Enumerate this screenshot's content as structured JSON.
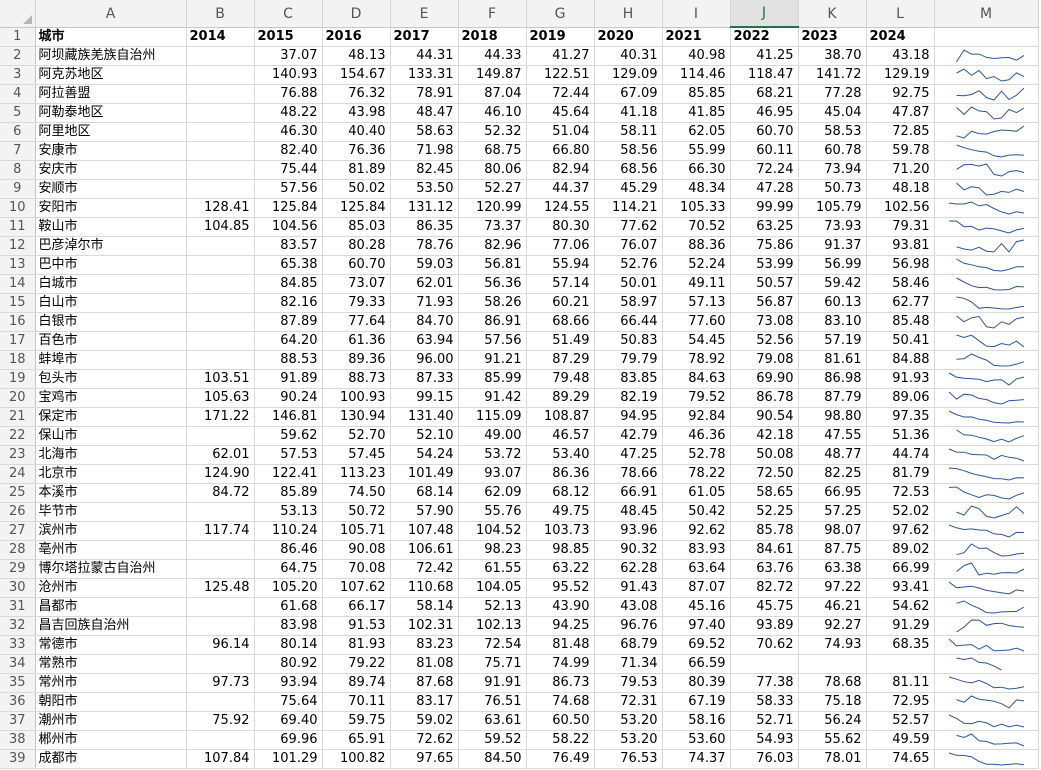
{
  "columns": [
    "A",
    "B",
    "C",
    "D",
    "E",
    "F",
    "G",
    "H",
    "I",
    "J",
    "K",
    "L",
    "M"
  ],
  "selected_column": "J",
  "header_row": [
    "城市",
    "2014",
    "2015",
    "2016",
    "2017",
    "2018",
    "2019",
    "2020",
    "2021",
    "2022",
    "2023",
    "2024"
  ],
  "rows": [
    [
      "阿坝藏族羌族自治州",
      "",
      "37.07",
      "48.13",
      "44.31",
      "44.33",
      "41.27",
      "40.31",
      "40.98",
      "41.25",
      "38.70",
      "43.18"
    ],
    [
      "阿克苏地区",
      "",
      "140.93",
      "154.67",
      "133.31",
      "149.87",
      "122.51",
      "129.09",
      "114.46",
      "118.47",
      "141.72",
      "129.19"
    ],
    [
      "阿拉善盟",
      "",
      "76.88",
      "76.32",
      "78.91",
      "87.04",
      "72.44",
      "67.09",
      "85.85",
      "68.21",
      "77.28",
      "92.75"
    ],
    [
      "阿勒泰地区",
      "",
      "48.22",
      "43.98",
      "48.47",
      "46.10",
      "45.64",
      "41.18",
      "41.85",
      "46.95",
      "45.04",
      "47.87"
    ],
    [
      "阿里地区",
      "",
      "46.30",
      "40.40",
      "58.63",
      "52.32",
      "51.04",
      "58.11",
      "62.05",
      "60.70",
      "58.53",
      "72.85"
    ],
    [
      "安康市",
      "",
      "82.40",
      "76.36",
      "71.98",
      "68.75",
      "66.80",
      "58.56",
      "55.99",
      "60.11",
      "60.78",
      "59.78"
    ],
    [
      "安庆市",
      "",
      "75.44",
      "81.89",
      "82.45",
      "80.06",
      "82.94",
      "68.56",
      "66.30",
      "72.24",
      "73.94",
      "71.20"
    ],
    [
      "安顺市",
      "",
      "57.56",
      "50.02",
      "53.50",
      "52.27",
      "44.37",
      "45.29",
      "48.34",
      "47.28",
      "50.73",
      "48.18"
    ],
    [
      "安阳市",
      "128.41",
      "125.84",
      "125.84",
      "131.12",
      "120.99",
      "124.55",
      "114.21",
      "105.33",
      "99.99",
      "105.79",
      "102.56"
    ],
    [
      "鞍山市",
      "104.85",
      "104.56",
      "85.03",
      "86.35",
      "73.37",
      "80.30",
      "77.62",
      "70.52",
      "63.25",
      "73.93",
      "79.31"
    ],
    [
      "巴彦淖尔市",
      "",
      "83.57",
      "80.28",
      "78.76",
      "82.96",
      "77.06",
      "76.07",
      "88.36",
      "75.86",
      "91.37",
      "93.81"
    ],
    [
      "巴中市",
      "",
      "65.38",
      "60.70",
      "59.03",
      "56.81",
      "55.94",
      "52.76",
      "52.24",
      "53.99",
      "56.99",
      "56.98"
    ],
    [
      "白城市",
      "",
      "84.85",
      "73.07",
      "62.01",
      "56.36",
      "57.14",
      "50.01",
      "49.11",
      "50.57",
      "59.42",
      "58.46"
    ],
    [
      "白山市",
      "",
      "82.16",
      "79.33",
      "71.93",
      "58.26",
      "60.21",
      "58.97",
      "57.13",
      "56.87",
      "60.13",
      "62.77"
    ],
    [
      "白银市",
      "",
      "87.89",
      "77.64",
      "84.70",
      "86.91",
      "68.66",
      "66.44",
      "77.60",
      "73.08",
      "83.10",
      "85.48"
    ],
    [
      "百色市",
      "",
      "64.20",
      "61.36",
      "63.94",
      "57.56",
      "51.49",
      "50.83",
      "54.45",
      "52.56",
      "57.19",
      "50.41"
    ],
    [
      "蚌埠市",
      "",
      "88.53",
      "89.36",
      "96.00",
      "91.21",
      "87.29",
      "79.79",
      "78.92",
      "79.08",
      "81.61",
      "84.88"
    ],
    [
      "包头市",
      "103.51",
      "91.89",
      "88.73",
      "87.33",
      "85.99",
      "79.48",
      "83.85",
      "84.63",
      "69.90",
      "86.98",
      "91.93"
    ],
    [
      "宝鸡市",
      "105.63",
      "90.24",
      "100.93",
      "99.15",
      "91.42",
      "89.29",
      "82.19",
      "79.52",
      "86.78",
      "87.79",
      "89.06"
    ],
    [
      "保定市",
      "171.22",
      "146.81",
      "130.94",
      "131.40",
      "115.09",
      "108.87",
      "94.95",
      "92.84",
      "90.54",
      "98.80",
      "97.35"
    ],
    [
      "保山市",
      "",
      "59.62",
      "52.70",
      "52.10",
      "49.00",
      "46.57",
      "42.79",
      "46.36",
      "42.18",
      "47.55",
      "51.36"
    ],
    [
      "北海市",
      "62.01",
      "57.53",
      "57.45",
      "54.24",
      "53.72",
      "53.40",
      "47.25",
      "52.78",
      "50.08",
      "48.77",
      "44.74"
    ],
    [
      "北京市",
      "124.90",
      "122.41",
      "113.23",
      "101.49",
      "93.07",
      "86.36",
      "78.66",
      "78.22",
      "72.50",
      "82.25",
      "81.79"
    ],
    [
      "本溪市",
      "84.72",
      "85.89",
      "74.50",
      "68.14",
      "62.09",
      "68.12",
      "66.91",
      "61.05",
      "58.65",
      "66.95",
      "72.53"
    ],
    [
      "毕节市",
      "",
      "53.13",
      "50.72",
      "57.90",
      "55.76",
      "49.75",
      "48.45",
      "50.42",
      "52.25",
      "57.25",
      "52.02"
    ],
    [
      "滨州市",
      "117.74",
      "110.24",
      "105.71",
      "107.48",
      "104.52",
      "103.73",
      "93.96",
      "92.62",
      "85.78",
      "98.07",
      "97.62"
    ],
    [
      "亳州市",
      "",
      "86.46",
      "90.08",
      "106.61",
      "98.23",
      "98.85",
      "90.32",
      "83.93",
      "84.61",
      "87.75",
      "89.02"
    ],
    [
      "博尔塔拉蒙古自治州",
      "",
      "64.75",
      "70.08",
      "72.42",
      "61.55",
      "63.22",
      "62.28",
      "63.64",
      "63.76",
      "63.38",
      "66.99"
    ],
    [
      "沧州市",
      "125.48",
      "105.20",
      "107.62",
      "110.68",
      "104.05",
      "95.52",
      "91.43",
      "87.07",
      "82.72",
      "97.22",
      "93.41"
    ],
    [
      "昌都市",
      "",
      "61.68",
      "66.17",
      "58.14",
      "52.13",
      "43.90",
      "43.08",
      "45.16",
      "45.75",
      "46.21",
      "54.62"
    ],
    [
      "昌吉回族自治州",
      "",
      "83.98",
      "91.53",
      "102.31",
      "102.13",
      "94.25",
      "96.76",
      "97.40",
      "93.89",
      "92.27",
      "91.29"
    ],
    [
      "常德市",
      "96.14",
      "80.14",
      "81.93",
      "83.23",
      "72.54",
      "81.48",
      "68.79",
      "69.52",
      "70.62",
      "74.93",
      "68.35"
    ],
    [
      "常熟市",
      "",
      "80.92",
      "79.22",
      "81.08",
      "75.71",
      "74.99",
      "71.34",
      "66.59",
      "",
      "",
      ""
    ],
    [
      "常州市",
      "97.73",
      "93.94",
      "89.74",
      "87.68",
      "91.91",
      "86.73",
      "79.53",
      "80.39",
      "77.38",
      "78.68",
      "81.11"
    ],
    [
      "朝阳市",
      "",
      "75.64",
      "70.11",
      "83.17",
      "76.51",
      "74.68",
      "72.31",
      "67.19",
      "58.33",
      "75.18",
      "72.95"
    ],
    [
      "潮州市",
      "75.92",
      "69.40",
      "59.75",
      "59.02",
      "63.61",
      "60.50",
      "53.20",
      "58.16",
      "52.71",
      "56.24",
      "52.57"
    ],
    [
      "郴州市",
      "",
      "69.96",
      "65.91",
      "72.62",
      "59.52",
      "58.22",
      "53.20",
      "53.60",
      "54.93",
      "55.62",
      "49.59"
    ],
    [
      "成都市",
      "107.84",
      "101.29",
      "100.82",
      "97.65",
      "84.50",
      "76.49",
      "76.53",
      "74.37",
      "76.03",
      "78.01",
      "74.65"
    ]
  ],
  "colors": {
    "sparkline": "#2f5597",
    "selected_header": "#217346",
    "gridline": "#d9d9d9",
    "header_bg": "#f3f3f3"
  }
}
